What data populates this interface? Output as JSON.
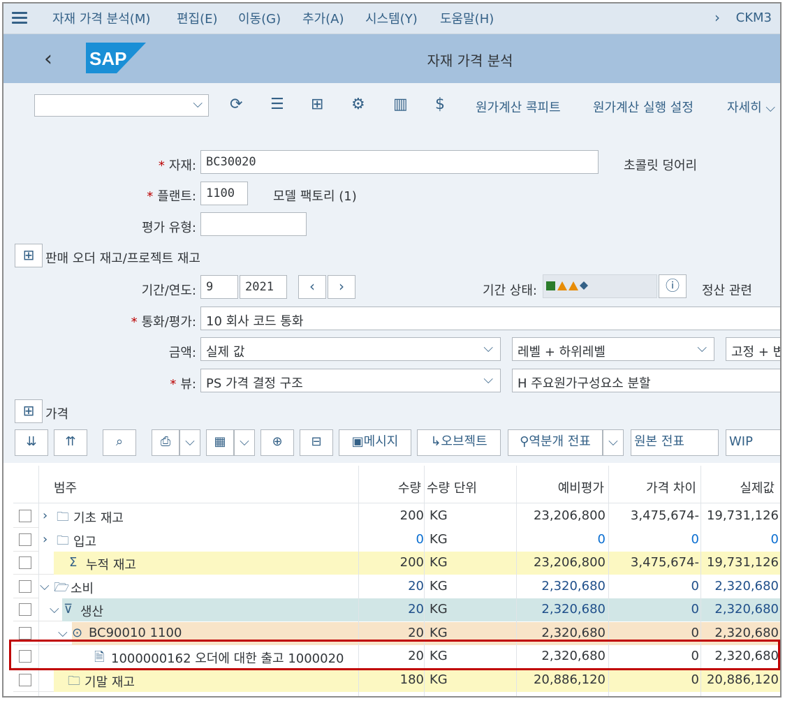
{
  "menu": {
    "items": [
      "자재 가격 분석(M)",
      "편집(E)",
      "이동(G)",
      "추가(A)",
      "시스템(Y)",
      "도움말(H)"
    ],
    "tcode": "CKM3"
  },
  "title": "자재 가격 분석",
  "toolbar": {
    "costing_cockpit": "원가계산 콕피트",
    "costing_run_settings": "원가계산 실행 설정",
    "more": "자세히"
  },
  "form": {
    "material_label": "자재:",
    "material_value": "BC30020",
    "material_desc": "초콜릿 덩어리",
    "plant_label": "플랜트:",
    "plant_value": "1100",
    "plant_desc": "모델 팩토리 (1)",
    "valuation_type_label": "평가 유형:",
    "valuation_type_value": "",
    "sales_order_section": "판매 오더 재고/프로젝트 재고",
    "period_label": "기간/연도:",
    "period_value": "9",
    "year_value": "2021",
    "period_status_label": "기간 상태:",
    "settlement_label": "정산 관련",
    "currency_label": "통화/평가:",
    "currency_value": "10 회사 코드 통화",
    "amount_label": "금액:",
    "amount_value": "실제 값",
    "level_value": "레벨 + 하위레벨",
    "fixed_value": "고정 + 변",
    "view_label": "뷰:",
    "view_value": "PS 가격 결정 구조",
    "split_value": "H 주요원가구성요소 분할",
    "price_section": "가격"
  },
  "table_toolbar": {
    "message": "메시지",
    "objects": "오브젝트",
    "reversal_doc": "역분개 전표",
    "original_doc": "원본 전표",
    "wip": "WIP"
  },
  "table": {
    "headers": [
      "범주",
      "수량",
      "수량 단위",
      "예비평가",
      "가격 차이",
      "실제값"
    ],
    "rows": [
      {
        "category": "기초 재고",
        "qty": "200",
        "unit": "KG",
        "prelim": "23,206,800",
        "diff": "3,475,674-",
        "actual": "19,731,126"
      },
      {
        "category": "입고",
        "qty": "0",
        "unit": "KG",
        "prelim": "0",
        "diff": "0",
        "actual": "0"
      },
      {
        "category": "누적 재고",
        "qty": "200",
        "unit": "KG",
        "prelim": "23,206,800",
        "diff": "3,475,674-",
        "actual": "19,731,126"
      },
      {
        "category": "소비",
        "qty": "20",
        "unit": "KG",
        "prelim": "2,320,680",
        "diff": "0",
        "actual": "2,320,680"
      },
      {
        "category": "생산",
        "qty": "20",
        "unit": "KG",
        "prelim": "2,320,680",
        "diff": "0",
        "actual": "2,320,680"
      },
      {
        "category": "BC90010 1100",
        "qty": "20",
        "unit": "KG",
        "prelim": "2,320,680",
        "diff": "0",
        "actual": "2,320,680"
      },
      {
        "category": "1000000162 오더에 대한 출고 1000020",
        "qty": "20",
        "unit": "KG",
        "prelim": "2,320,680",
        "diff": "0",
        "actual": "2,320,680"
      },
      {
        "category": "기말 재고",
        "qty": "180",
        "unit": "KG",
        "prelim": "20,886,120",
        "diff": "0",
        "actual": "20,886,120"
      }
    ]
  },
  "colors": {
    "accent": "#346187",
    "title_bar": "#a5c1dd",
    "menu_bar": "#dfe8f1",
    "form_bg": "#edf2f7",
    "row_yellow": "#fcf8c2",
    "row_teal": "#d1e6e6",
    "row_orange": "#f8e4c8",
    "highlight_border": "#c00000"
  }
}
